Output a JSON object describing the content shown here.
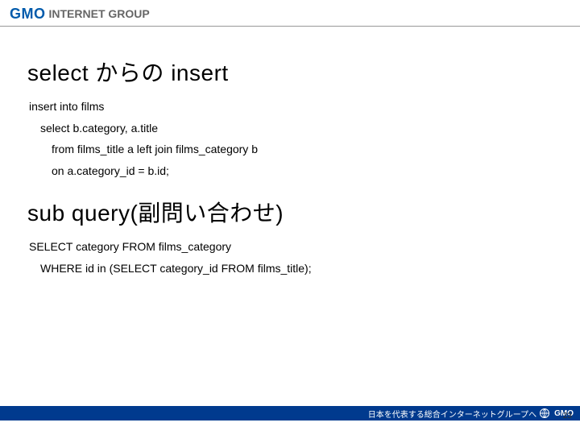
{
  "header": {
    "logo_primary": "GMO",
    "logo_secondary": "INTERNET GROUP"
  },
  "sections": {
    "s1": {
      "title": "select からの insert",
      "lines": {
        "a": "insert into films",
        "b": "select b.category, a.title",
        "c": "from films_title a left join films_category b",
        "d": "on a.category_id = b.id;"
      }
    },
    "s2": {
      "title": "sub query(副問い合わせ)",
      "lines": {
        "a": "SELECT category FROM films_category",
        "b": "WHERE id in (SELECT category_id FROM films_title);"
      }
    }
  },
  "footer": {
    "tagline": "日本を代表する総合インターネットグループへ",
    "brand": "GMO",
    "page_number": "23"
  }
}
